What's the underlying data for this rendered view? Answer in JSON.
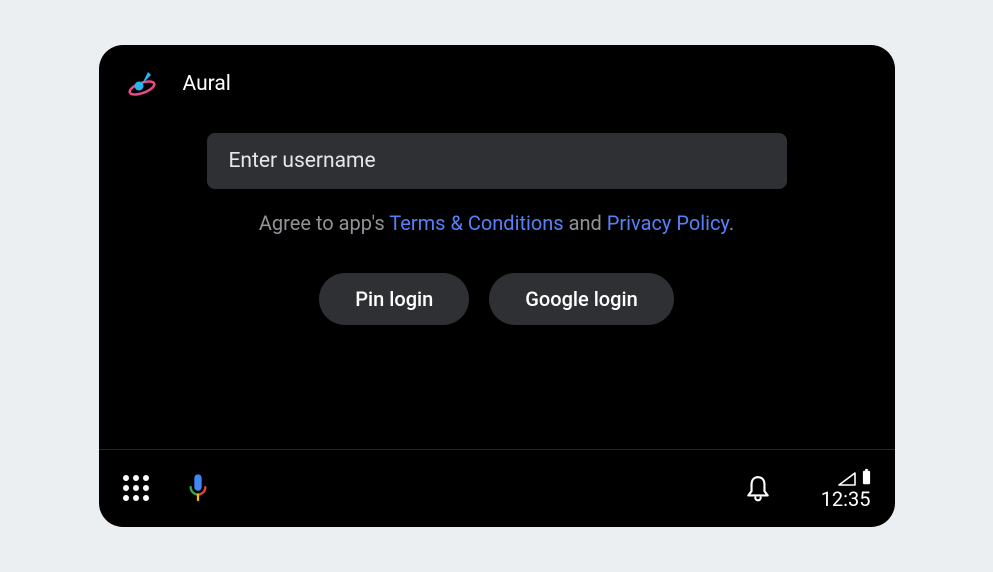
{
  "app": {
    "title": "Aural"
  },
  "login": {
    "username_placeholder": "Enter username",
    "consent_prefix": "Agree to app's ",
    "terms_label": "Terms & Conditions",
    "consent_middle": " and ",
    "privacy_label": "Privacy Policy",
    "consent_suffix": ".",
    "pin_button": "Pin login",
    "google_button": "Google login"
  },
  "statusbar": {
    "clock": "12:35"
  }
}
